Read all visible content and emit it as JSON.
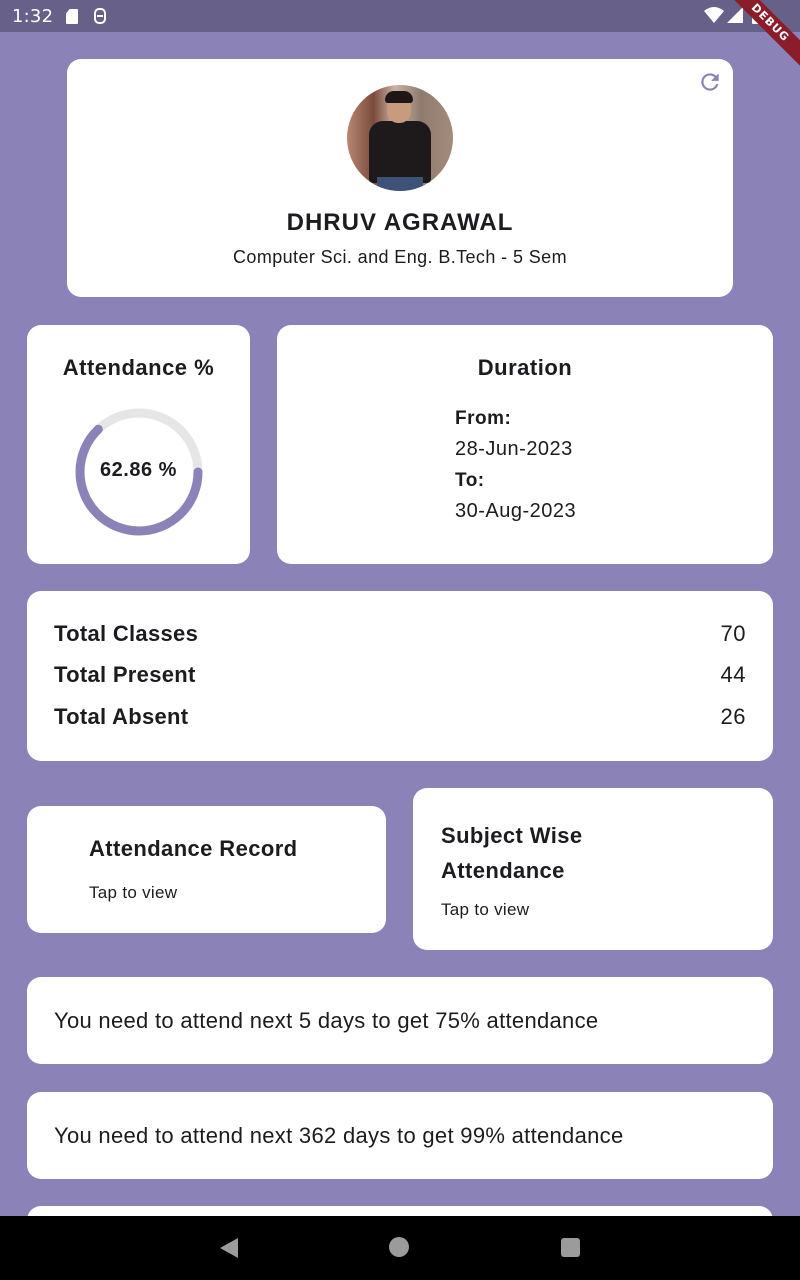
{
  "status_bar": {
    "time": "1:32",
    "icons": [
      "sd-card-icon",
      "debug-notification-icon",
      "wifi-icon",
      "signal-icon",
      "battery-icon"
    ]
  },
  "debug_banner": "DEBUG",
  "theme": {
    "background": "#8b82b8",
    "accent": "#8b82b8",
    "ring_track": "#e6e6e6",
    "card": "#ffffff",
    "text": "#1d1b20"
  },
  "profile": {
    "name": "DHRUV AGRAWAL",
    "course": "Computer Sci. and Eng. B.Tech - 5 Sem",
    "refresh_icon": "refresh-icon",
    "avatar": "profile-photo"
  },
  "attendance": {
    "title": "Attendance %",
    "percent_label": "62.86 %",
    "percent_value": 62.86
  },
  "duration": {
    "title": "Duration",
    "from_label": "From:",
    "from_value": "28-Jun-2023",
    "to_label": "To:",
    "to_value": "30-Aug-2023"
  },
  "totals": [
    {
      "label": "Total Classes",
      "value": "70"
    },
    {
      "label": "Total Present",
      "value": "44"
    },
    {
      "label": "Total Absent",
      "value": "26"
    }
  ],
  "nav_cards": {
    "record": {
      "title": "Attendance Record",
      "subtitle": "Tap to view"
    },
    "subject": {
      "title": "Subject Wise Attendance",
      "subtitle": "Tap to view"
    }
  },
  "messages": [
    "You need to attend next 5 days to get 75% attendance",
    "You need to attend next 362 days to get 99% attendance",
    ""
  ],
  "nav_bar": {
    "back": "back-icon",
    "home": "home-icon",
    "recents": "recents-icon"
  }
}
